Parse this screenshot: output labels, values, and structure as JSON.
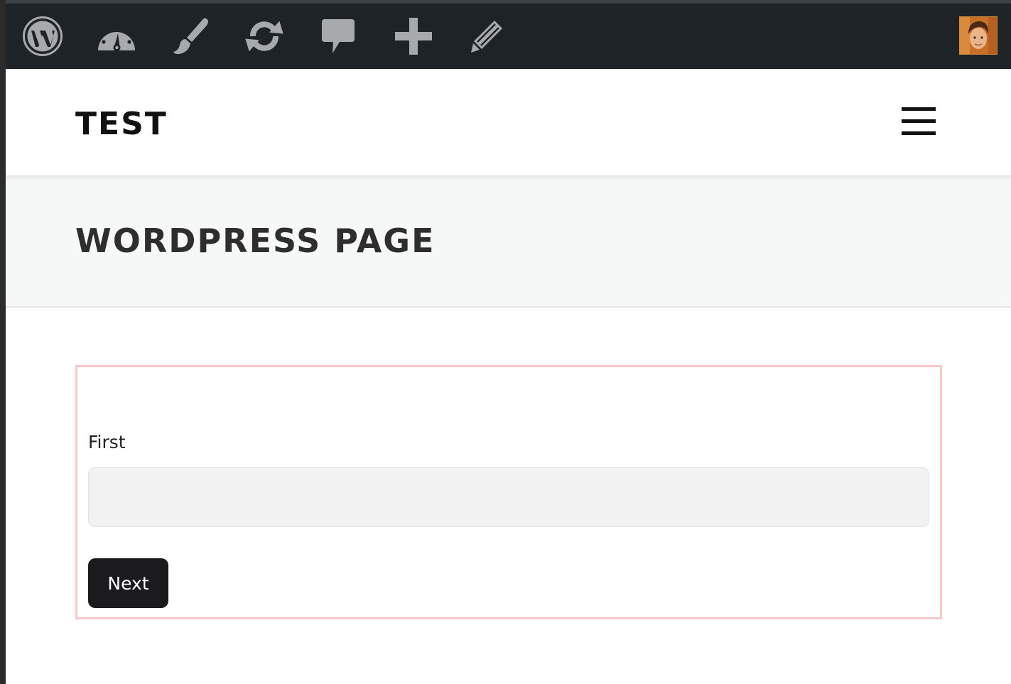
{
  "admin_bar": {
    "icons": [
      {
        "name": "wordpress-logo-icon"
      },
      {
        "name": "dashboard-icon"
      },
      {
        "name": "customize-brush-icon"
      },
      {
        "name": "updates-icon"
      },
      {
        "name": "comments-icon"
      },
      {
        "name": "new-content-icon"
      },
      {
        "name": "edit-icon"
      }
    ],
    "icon_color": "#a7aaad",
    "background": "#1e2327"
  },
  "site": {
    "title": "TEST"
  },
  "page": {
    "title": "WORDPRESS PAGE"
  },
  "form": {
    "border_color": "#f7c9cb",
    "first_label": "First",
    "first_value": "",
    "next_label": "Next"
  }
}
